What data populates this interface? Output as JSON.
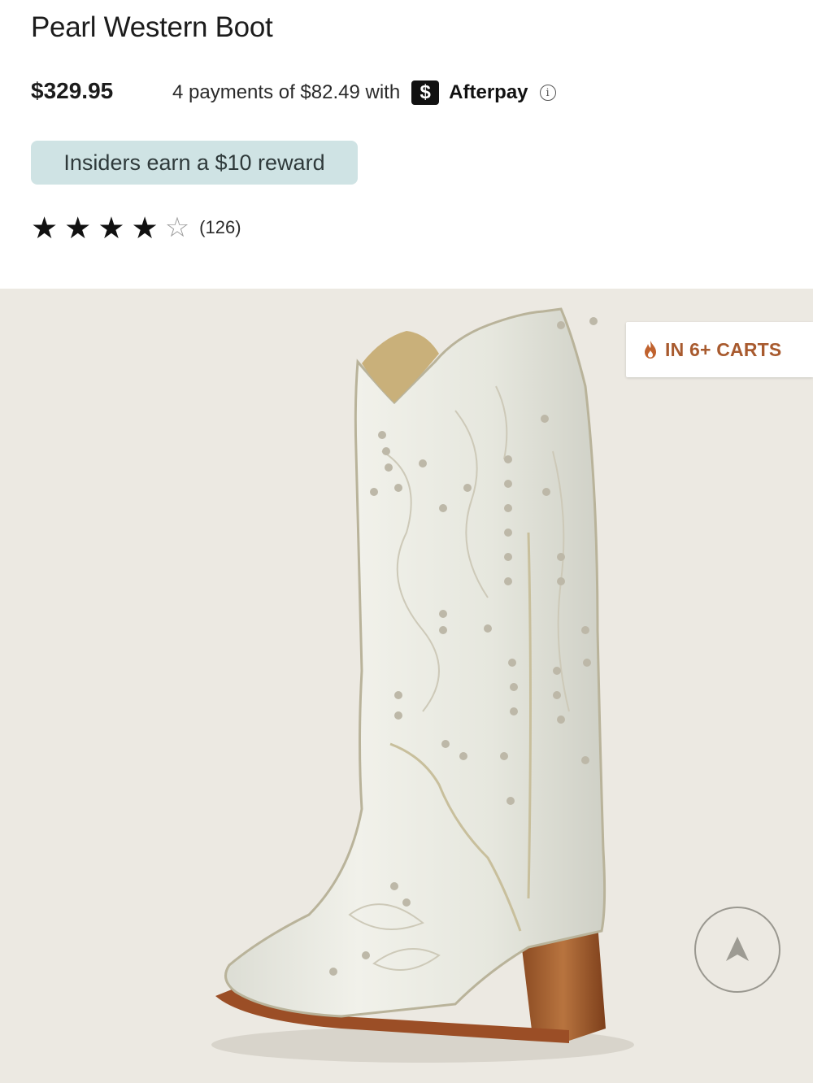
{
  "product": {
    "title": "Pearl Western Boot",
    "price": "$329.95",
    "installments": "4 payments of $82.49 with",
    "afterpay_logo_glyph": "$",
    "afterpay_name": "Afterpay",
    "info_glyph": "i",
    "reward_badge": "Insiders earn a $10 reward",
    "rating": {
      "stars": 4,
      "max": 5,
      "count": "(126)"
    }
  },
  "image": {
    "alt": "Pearl Western Boot",
    "cart_badge": "IN 6+ CARTS",
    "cart_icon": "flame-icon",
    "scroll_icon": "arrow-up-icon"
  },
  "colors": {
    "reward_bg": "#cfe3e4",
    "image_bg": "#ece9e2",
    "cart_text": "#a85a2e",
    "star": "#111111"
  }
}
